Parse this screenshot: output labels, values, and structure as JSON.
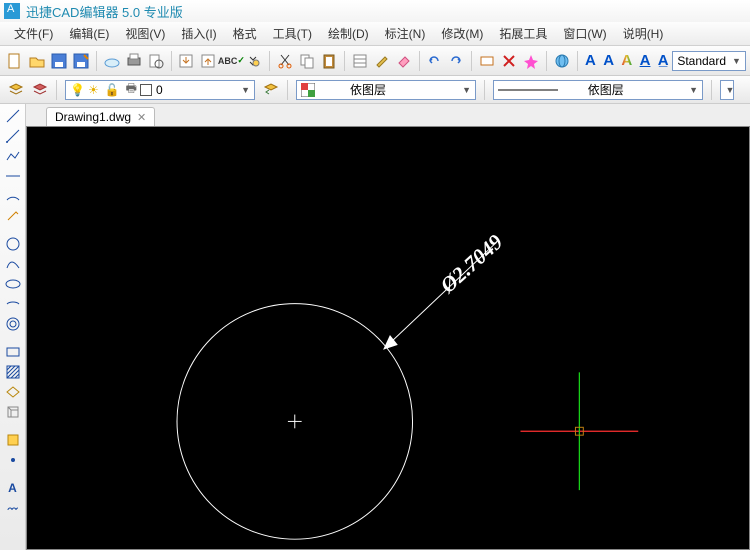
{
  "app": {
    "title": "迅捷CAD编辑器 5.0 专业版"
  },
  "menu": {
    "file": "文件(F)",
    "edit": "编辑(E)",
    "view": "视图(V)",
    "insert": "插入(I)",
    "format": "格式",
    "tools": "工具(T)",
    "draw": "绘制(D)",
    "dim": "标注(N)",
    "modify": "修改(M)",
    "expand": "拓展工具",
    "window": "窗口(W)",
    "help": "说明(H)"
  },
  "style_combo": {
    "value": "Standard"
  },
  "layer": {
    "name": "0",
    "bylayer1": "依图层",
    "bylayer2": "依图层"
  },
  "document": {
    "tab_name": "Drawing1.dwg"
  },
  "drawing": {
    "dimension_text": "Ø2.7049"
  },
  "colors": {
    "cursor_x": "#ff3030",
    "cursor_y": "#18d018",
    "circle": "#ffffff"
  }
}
